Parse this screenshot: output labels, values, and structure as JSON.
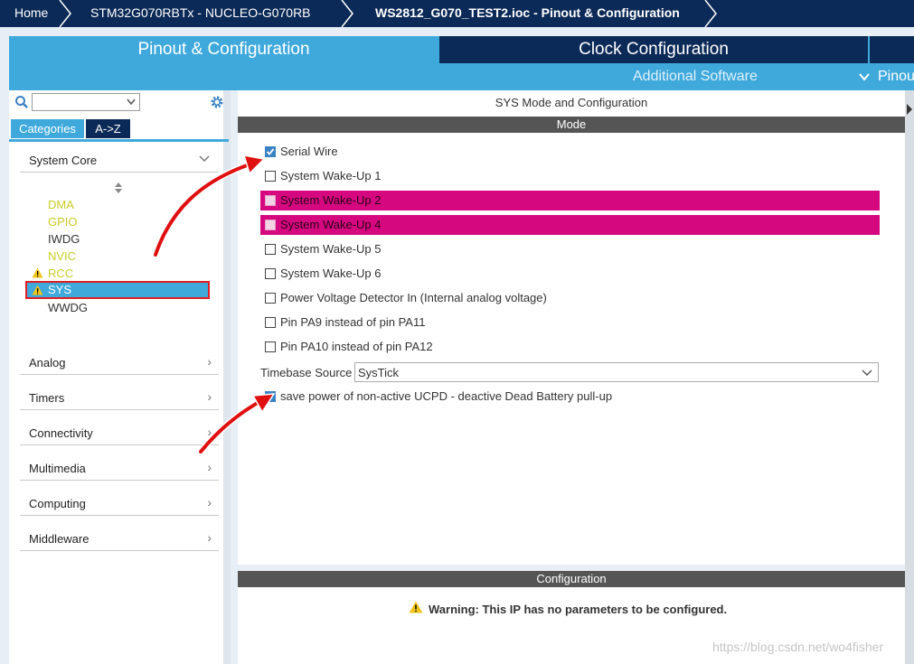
{
  "breadcrumb": [
    "Home",
    "STM32G070RBTx  -  NUCLEO-G070RB",
    "WS2812_G070_TEST2.ioc - Pinout & Configuration"
  ],
  "tabs": {
    "pinout": "Pinout & Configuration",
    "clock": "Clock Configuration",
    "additional": "Additional Software",
    "pinout_menu": "Pinou"
  },
  "left": {
    "search_value": "",
    "cat_tabs": [
      "Categories",
      "A->Z"
    ],
    "groups": {
      "system_core": "System Core",
      "analog": "Analog",
      "timers": "Timers",
      "connectivity": "Connectivity",
      "multimedia": "Multimedia",
      "computing": "Computing",
      "middleware": "Middleware"
    },
    "ips": [
      "DMA",
      "GPIO",
      "IWDG",
      "NVIC",
      "RCC",
      "SYS",
      "WWDG"
    ]
  },
  "right": {
    "title": "SYS Mode and Configuration",
    "mode_header": "Mode",
    "options": [
      "Serial Wire",
      "System Wake-Up 1",
      "System Wake-Up 2",
      "System Wake-Up 4",
      "System Wake-Up 5",
      "System Wake-Up 6",
      "Power Voltage Detector In (Internal analog voltage)",
      "Pin PA9 instead of pin PA11",
      "Pin PA10 instead of pin PA12"
    ],
    "timebase_label": "Timebase Source",
    "timebase_value": "SysTick",
    "ucpd_option": "save power of non-active UCPD - deactive Dead Battery pull-up",
    "config_header": "Configuration",
    "warning": "Warning: This IP has no parameters to be configured."
  },
  "watermark": "https://blog.csdn.net/wo4fisher",
  "colors": {
    "navy": "#0c2a57",
    "blue": "#3fa9dc",
    "pink": "#d6087f",
    "warn": "#c8cc2a",
    "arrow": "#e01010"
  }
}
